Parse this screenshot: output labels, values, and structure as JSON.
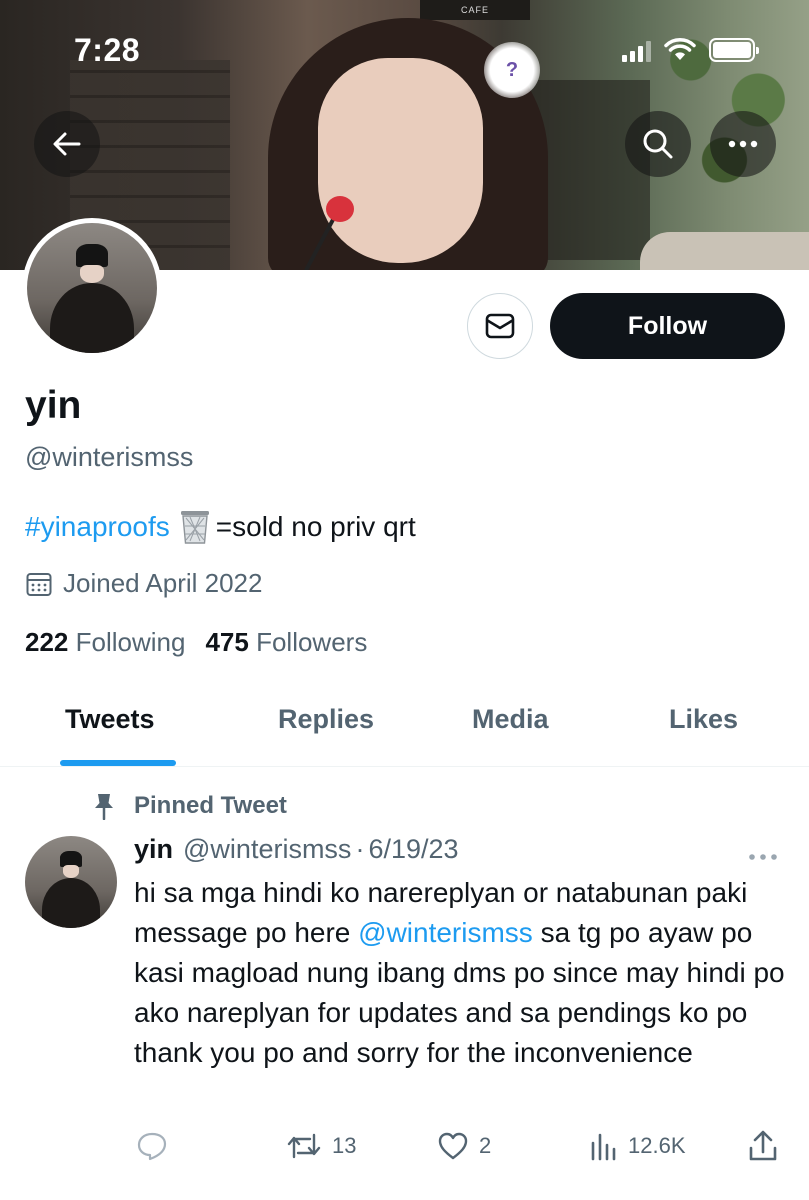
{
  "status_bar": {
    "time": "7:28"
  },
  "banner": {
    "sign_text": "CAFE"
  },
  "profile": {
    "follow_label": "Follow",
    "display_name": "yin",
    "handle": "@winterismss",
    "bio_hashtag": "#yinaproofs",
    "bio_icon": "wastebasket-emoji",
    "bio_rest": "=sold no priv qrt",
    "joined": "Joined April 2022",
    "following_count": "222",
    "following_label": "Following",
    "followers_count": "475",
    "followers_label": "Followers"
  },
  "tabs": [
    {
      "label": "Tweets",
      "active": true
    },
    {
      "label": "Replies",
      "active": false
    },
    {
      "label": "Media",
      "active": false
    },
    {
      "label": "Likes",
      "active": false
    }
  ],
  "pinned_tweet": {
    "pinned_label": "Pinned Tweet",
    "author_name": "yin",
    "author_handle": "@winterismss",
    "separator": "·",
    "date": "6/19/23",
    "text_before_mention": "hi sa mga hindi ko narereplyan or natabunan paki message po here ",
    "mention": "@winterismss",
    "text_after_mention": " sa tg po ayaw po kasi magload nung ibang dms po since may hindi po ako nareplyan for updates and sa pendings ko po thank you po and sorry for the inconvenience",
    "reply_count": "",
    "retweet_count": "13",
    "like_count": "2",
    "view_count": "12.6K"
  },
  "colors": {
    "accent": "#1d9bf0",
    "text_primary": "#0f1419",
    "text_secondary": "#536471",
    "follow_button": "#0f1419"
  }
}
